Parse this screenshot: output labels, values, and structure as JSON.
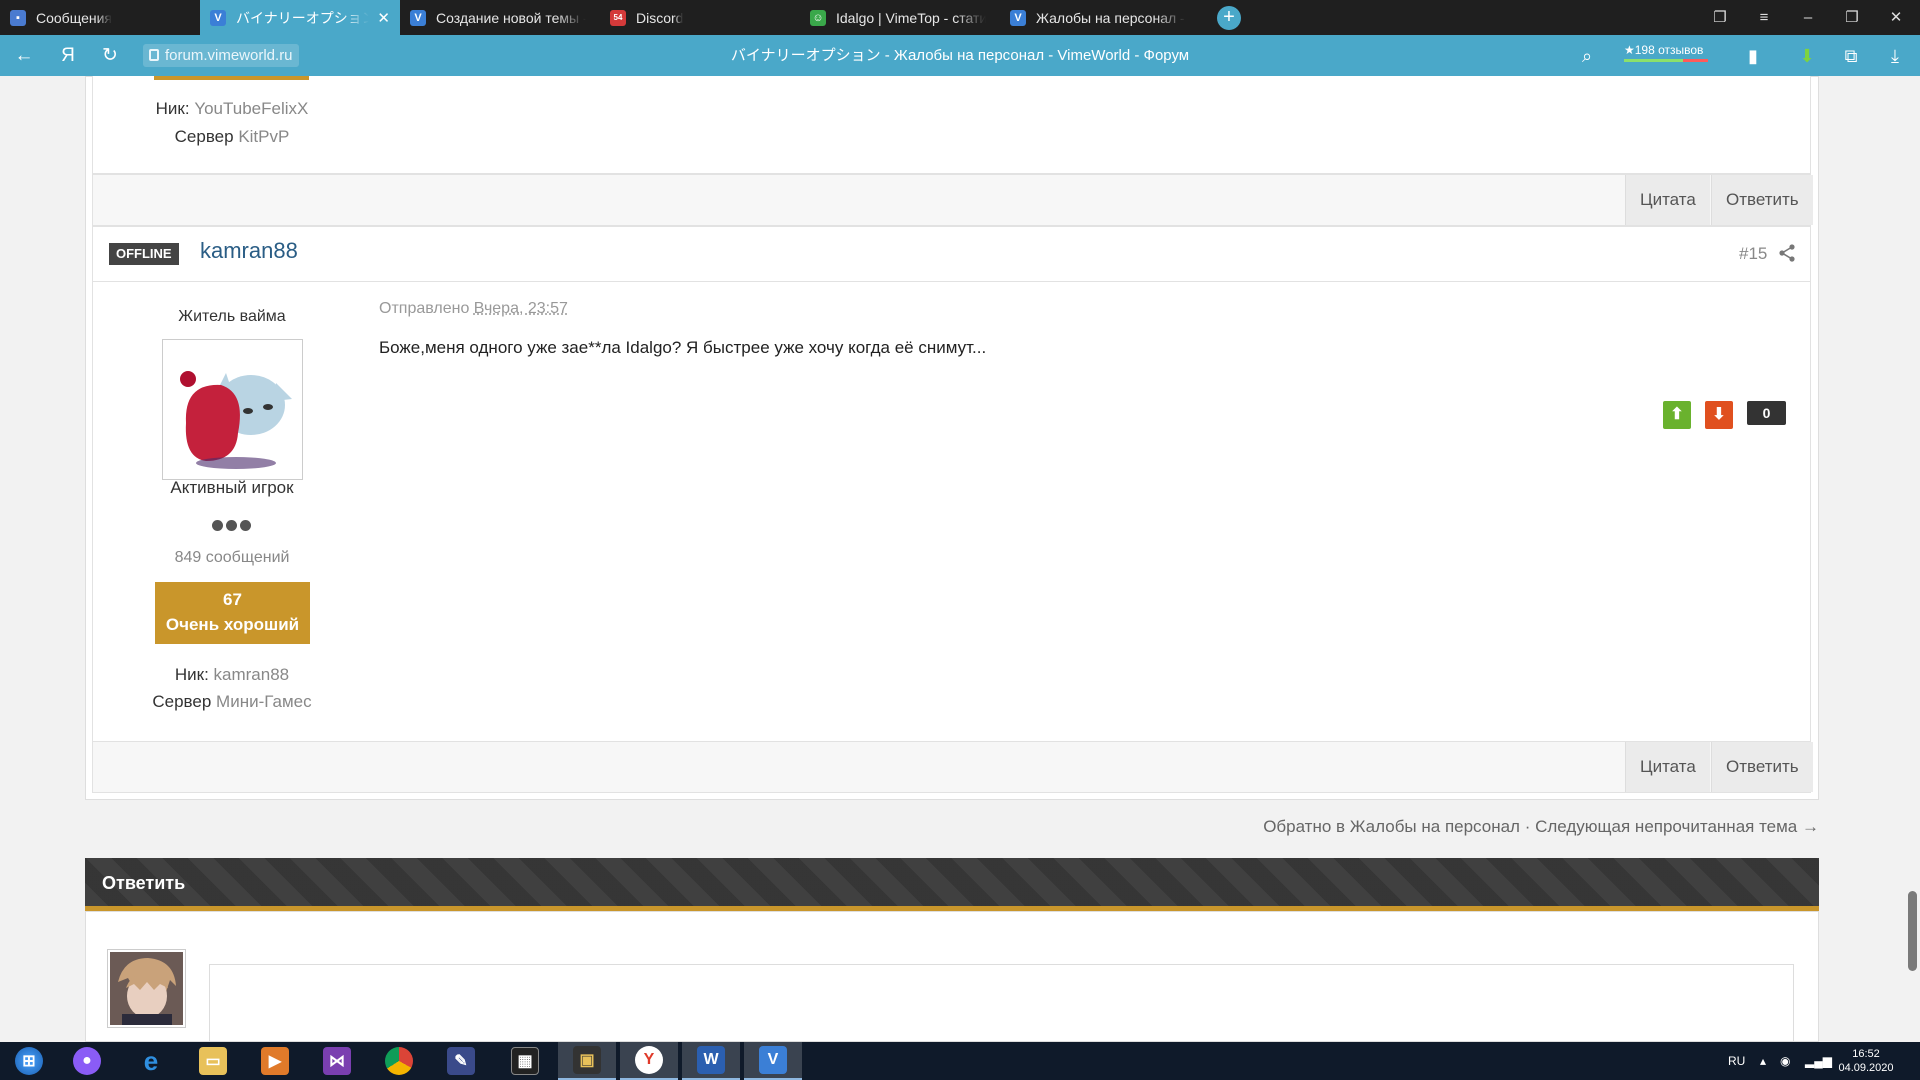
{
  "browser": {
    "tabs": [
      {
        "title": "Сообщения",
        "icon": "chat-bubble-icon",
        "color": "#4a7bd0"
      },
      {
        "title": "バイナリーオプション - Жалобы на персонал - VimeWorld - Форум",
        "icon": "vimeworld-icon",
        "color": "#3b7fd6",
        "close": "✕"
      },
      {
        "title": "Создание новой темы - VimeWorld - Форум",
        "icon": "vimeworld-icon",
        "color": "#3b7fd6"
      },
      {
        "title": "Discord",
        "icon": "discord-icon",
        "color": "#d43a3a",
        "badge": "54"
      },
      {
        "title": "Idalgo | VimeTop - статистика игрока",
        "icon": "vimetop-icon",
        "color": "#3aa84a"
      },
      {
        "title": "Жалобы на персонал - VimeWorld - Форум",
        "icon": "vimeworld-icon",
        "color": "#3b7fd6"
      }
    ],
    "new_tab": "+",
    "url": "forum.vimeworld.ru",
    "page_title": "バイナリーオプション - Жалобы на персонал - VimeWorld - Форум",
    "reviews": "★198 отзывов",
    "yandex_letter": "Я"
  },
  "prev_post": {
    "nick_label": "Ник:",
    "nick": "YouTubeFelixX",
    "server_label": "Сервер",
    "server": "KitPvP",
    "quote_btn": "Цитата",
    "reply_btn": "Ответить"
  },
  "post": {
    "status": "OFFLINE",
    "author": "kamran88",
    "number": "#15",
    "title": "Житель вайма",
    "group": "Активный игрок",
    "messages": "849 сообщений",
    "reputation": "67",
    "reputation_label": "Очень хороший",
    "nick_label": "Ник:",
    "nick": "kamran88",
    "server_label": "Сервер",
    "server": "Мини-Гамес",
    "sent_prefix": "Отправлено",
    "sent_time": "Вчера, 23:57",
    "body": "Боже,меня одного уже зае**ла Idalgo? Я быстрее уже хочу когда её снимут...",
    "vote_count": "0",
    "quote_btn": "Цитата",
    "reply_btn": "Ответить"
  },
  "thread_nav": {
    "back": "Обратно в Жалобы на персонал",
    "sep": "·",
    "next": "Следующая непрочитанная тема →"
  },
  "reply": {
    "header": "Ответить"
  },
  "taskbar": {
    "lang": "RU",
    "time": "16:52",
    "date": "04.09.2020"
  },
  "colors": {
    "accent": "#4aa8c9",
    "reputation": "#c9962b",
    "upvote": "#6ab22e",
    "downvote": "#e0501f",
    "username": "#2a5d85"
  }
}
